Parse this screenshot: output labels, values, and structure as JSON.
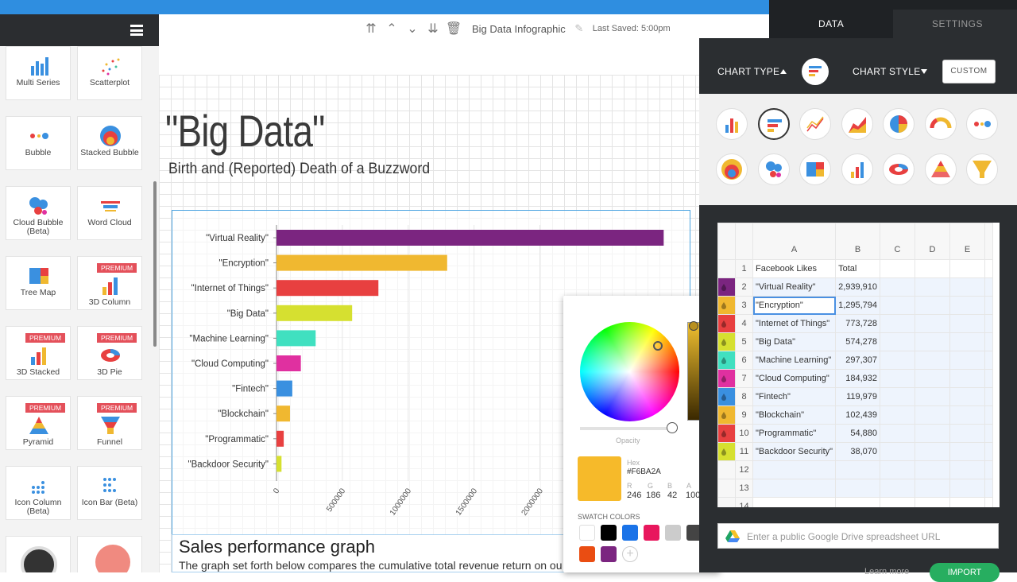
{
  "toolbar": {
    "doc_title": "Big Data Infographic",
    "saved": "Last Saved: 5:00pm"
  },
  "canvas": {
    "title": "\"Big Data\"",
    "subtitle": "Birth and (Reported) Death of a Buzzword",
    "textbox_heading": "Sales performance graph",
    "textbox_body": "The graph set forth below compares the cumulative total revenue return on ou"
  },
  "sidebar": {
    "tiles": [
      {
        "label": "Multi Series",
        "icon": "multi-series-icon",
        "premium": ""
      },
      {
        "label": "Scatterplot",
        "icon": "scatterplot-icon",
        "premium": ""
      },
      {
        "label": "Bubble",
        "icon": "bubble-icon",
        "premium": ""
      },
      {
        "label": "Stacked Bubble",
        "icon": "stacked-bubble-icon",
        "premium": ""
      },
      {
        "label": "Cloud Bubble (Beta)",
        "icon": "cloud-bubble-icon",
        "premium": ""
      },
      {
        "label": "Word Cloud",
        "icon": "word-cloud-icon",
        "premium": ""
      },
      {
        "label": "Tree Map",
        "icon": "tree-map-icon",
        "premium": ""
      },
      {
        "label": "3D Column",
        "icon": "3d-column-icon",
        "premium": "PREMIUM"
      },
      {
        "label": "3D Stacked",
        "icon": "3d-stacked-icon",
        "premium": "PREMIUM"
      },
      {
        "label": "3D Pie",
        "icon": "3d-pie-icon",
        "premium": "PREMIUM"
      },
      {
        "label": "Pyramid",
        "icon": "pyramid-icon",
        "premium": "PREMIUM"
      },
      {
        "label": "Funnel",
        "icon": "funnel-icon",
        "premium": "PREMIUM"
      },
      {
        "label": "Icon Column (Beta)",
        "icon": "icon-column-icon",
        "premium": ""
      },
      {
        "label": "Icon Bar (Beta)",
        "icon": "icon-bar-icon",
        "premium": ""
      }
    ]
  },
  "chart_data": {
    "type": "bar",
    "orientation": "horizontal",
    "categories": [
      "\"Virtual Reality\"",
      "\"Encryption\"",
      "\"Internet of Things\"",
      "\"Big Data\"",
      "\"Machine Learning\"",
      "\"Cloud Computing\"",
      "\"Fintech\"",
      "\"Blockchain\"",
      "\"Programmatic\"",
      "\"Backdoor Security\""
    ],
    "values": [
      2939910,
      1295794,
      773728,
      574278,
      297307,
      184932,
      119979,
      102439,
      54880,
      38070
    ],
    "colors": [
      "#7b2580",
      "#f0b830",
      "#e84040",
      "#d6e030",
      "#40e0c0",
      "#e030a0",
      "#3a90e0",
      "#f0b830",
      "#e84040",
      "#d6e030"
    ],
    "xticks": [
      "0",
      "500000",
      "1000000",
      "1500000",
      "2000000"
    ],
    "xlim": [
      0,
      2950000
    ],
    "grid": true
  },
  "color_picker": {
    "opacity_label": "Opacity",
    "hex_label": "Hex",
    "hex_value": "#F6BA2A",
    "r_label": "R",
    "g_label": "G",
    "b_label": "B",
    "a_label": "A",
    "r": "246",
    "g": "186",
    "b": "42",
    "a": "100",
    "swatch_label": "SWATCH COLORS",
    "current_color": "#f6ba2a",
    "swatches": [
      "#ffffff",
      "#000000",
      "#1a73e8",
      "#e8175d",
      "#cccccc",
      "#444444",
      "#ea4d12",
      "#7b2580"
    ]
  },
  "right_panel": {
    "tab_data": "DATA",
    "tab_settings": "SETTINGS",
    "chart_type_label": "CHART TYPE",
    "chart_style_label": "CHART STYLE",
    "custom_label": "CUSTOM",
    "chart_types": [
      "column-chart-icon",
      "bar-chart-icon",
      "line-chart-icon",
      "area-chart-icon",
      "pie-chart-icon",
      "gauge-chart-icon",
      "bubble-chart-icon",
      "stacked-bubble-chart-icon",
      "cloud-bubble-chart-icon",
      "treemap-chart-icon",
      "3d-column-chart-icon",
      "3d-pie-chart-icon",
      "pyramid-chart-icon",
      "funnel-chart-icon"
    ]
  },
  "sheet": {
    "columns": [
      "A",
      "B",
      "C",
      "D",
      "E"
    ],
    "rows": [
      {
        "n": "1",
        "a": "Facebook Likes",
        "b": "Total",
        "color": ""
      },
      {
        "n": "2",
        "a": "\"Virtual Reality\"",
        "b": "2,939,910",
        "color": "#7b2580"
      },
      {
        "n": "3",
        "a": "\"Encryption\"",
        "b": "1,295,794",
        "color": "#f0b830"
      },
      {
        "n": "4",
        "a": "\"Internet of Things\"",
        "b": "773,728",
        "color": "#e84040"
      },
      {
        "n": "5",
        "a": "\"Big Data\"",
        "b": "574,278",
        "color": "#d6e030"
      },
      {
        "n": "6",
        "a": "\"Machine Learning\"",
        "b": "297,307",
        "color": "#40e0c0"
      },
      {
        "n": "7",
        "a": "\"Cloud Computing\"",
        "b": "184,932",
        "color": "#e030a0"
      },
      {
        "n": "8",
        "a": "\"Fintech\"",
        "b": "119,979",
        "color": "#3a90e0"
      },
      {
        "n": "9",
        "a": "\"Blockchain\"",
        "b": "102,439",
        "color": "#f0b830"
      },
      {
        "n": "10",
        "a": "\"Programmatic\"",
        "b": "54,880",
        "color": "#e84040"
      },
      {
        "n": "11",
        "a": "\"Backdoor Security\"",
        "b": "38,070",
        "color": "#d6e030"
      },
      {
        "n": "12",
        "a": "",
        "b": "",
        "color": ""
      },
      {
        "n": "13",
        "a": "",
        "b": "",
        "color": ""
      },
      {
        "n": "14",
        "a": "",
        "b": "",
        "color": ""
      }
    ],
    "url_placeholder": "Enter a public Google Drive spreadsheet URL",
    "learn_more": "Learn more",
    "import_label": "IMPORT"
  }
}
